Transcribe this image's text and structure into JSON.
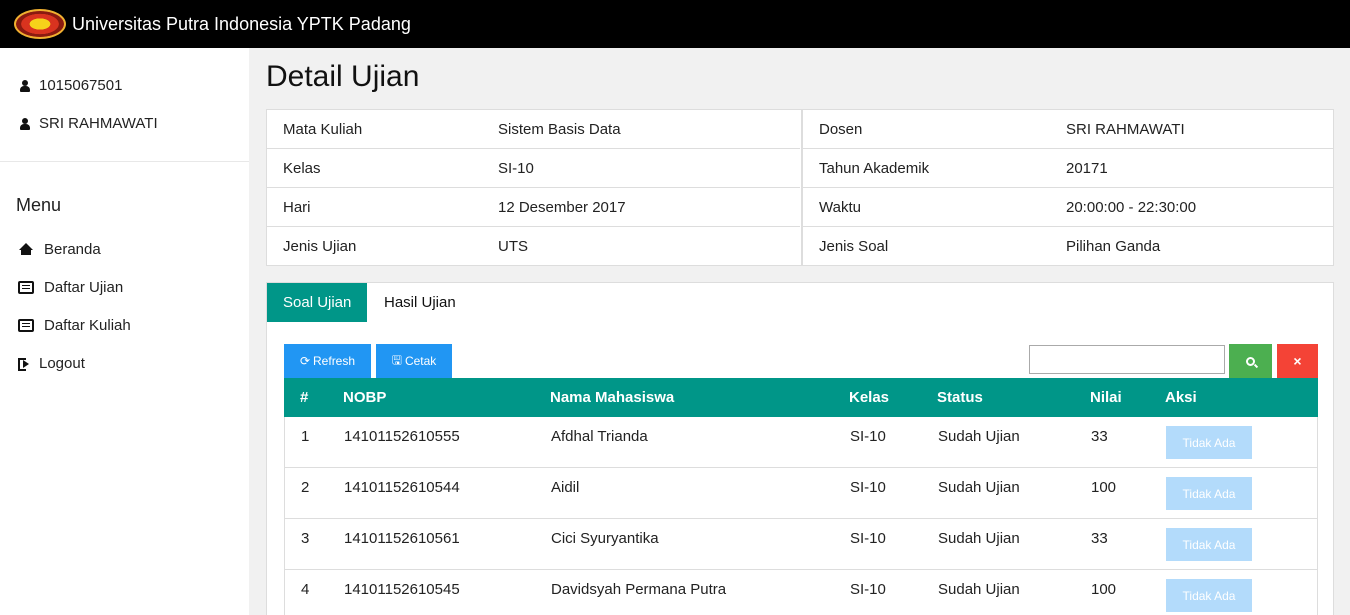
{
  "header": {
    "title": "Universitas Putra Indonesia YPTK Padang"
  },
  "user": {
    "id": "1015067501",
    "name": "SRI RAHMAWATI"
  },
  "menu": {
    "heading": "Menu",
    "items": [
      {
        "label": "Beranda",
        "icon": "home-icon"
      },
      {
        "label": "Daftar Ujian",
        "icon": "list-icon"
      },
      {
        "label": "Daftar Kuliah",
        "icon": "list-icon"
      },
      {
        "label": "Logout",
        "icon": "sign-out-icon"
      }
    ]
  },
  "page": {
    "title": "Detail Ujian"
  },
  "info": {
    "left": [
      {
        "key": "Mata Kuliah",
        "value": "Sistem Basis Data"
      },
      {
        "key": "Kelas",
        "value": "SI-10"
      },
      {
        "key": "Hari",
        "value": "12 Desember 2017"
      },
      {
        "key": "Jenis Ujian",
        "value": "UTS"
      }
    ],
    "right": [
      {
        "key": "Dosen",
        "value": "SRI RAHMAWATI"
      },
      {
        "key": "Tahun Akademik",
        "value": "20171"
      },
      {
        "key": "Waktu",
        "value": "20:00:00 - 22:30:00"
      },
      {
        "key": "Jenis Soal",
        "value": "Pilihan Ganda"
      }
    ]
  },
  "tabs": [
    {
      "label": "Soal Ujian",
      "active": true
    },
    {
      "label": "Hasil Ujian",
      "active": false
    }
  ],
  "toolbar": {
    "refresh_label": "Refresh",
    "print_label": "Cetak",
    "search_value": "",
    "clear_label": "×"
  },
  "table": {
    "columns": [
      "#",
      "NOBP",
      "Nama Mahasiswa",
      "Kelas",
      "Status",
      "Nilai",
      "Aksi"
    ],
    "rows": [
      {
        "no": "1",
        "nobp": "14101152610555",
        "nama": "Afdhal Trianda",
        "kelas": "SI-10",
        "status": "Sudah Ujian",
        "nilai": "33",
        "aksi": "Tidak Ada"
      },
      {
        "no": "2",
        "nobp": "14101152610544",
        "nama": "Aidil",
        "kelas": "SI-10",
        "status": "Sudah Ujian",
        "nilai": "100",
        "aksi": "Tidak Ada"
      },
      {
        "no": "3",
        "nobp": "14101152610561",
        "nama": "Cici Syuryantika",
        "kelas": "SI-10",
        "status": "Sudah Ujian",
        "nilai": "33",
        "aksi": "Tidak Ada"
      },
      {
        "no": "4",
        "nobp": "14101152610545",
        "nama": "Davidsyah Permana Putra",
        "kelas": "SI-10",
        "status": "Sudah Ujian",
        "nilai": "100",
        "aksi": "Tidak Ada"
      }
    ]
  },
  "colors": {
    "teal": "#009688",
    "blue": "#2196f3",
    "green": "#4caf50",
    "red": "#f44336",
    "disabled": "#b3dbfb"
  }
}
